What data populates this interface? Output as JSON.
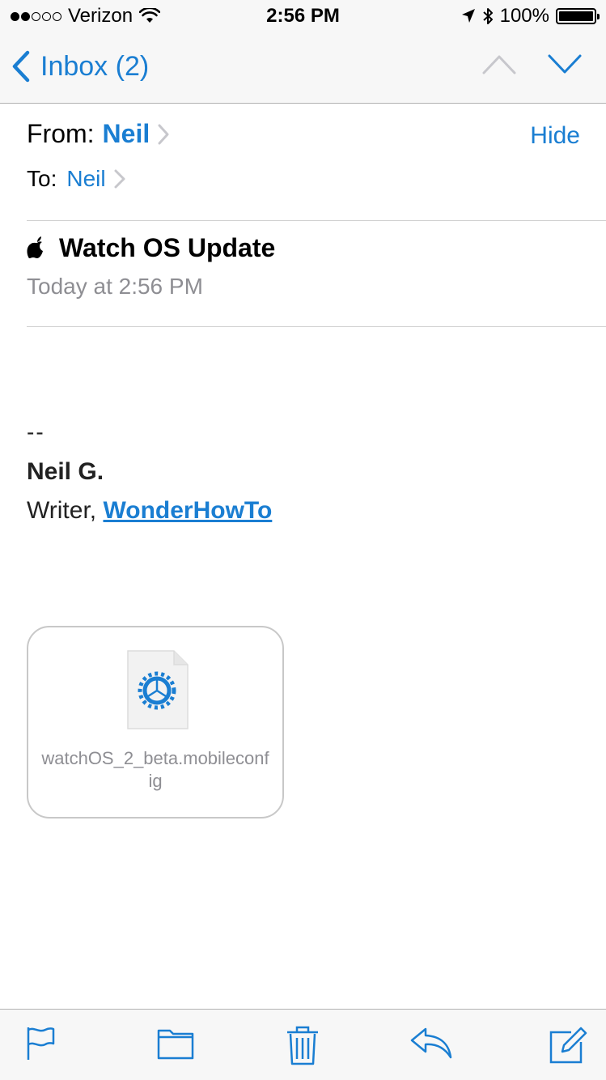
{
  "status_bar": {
    "carrier": "Verizon",
    "time": "2:56 PM",
    "battery": "100%",
    "signal_strength": 2
  },
  "nav": {
    "back_label": "Inbox (2)",
    "up_icon": "chevron-up-icon",
    "down_icon": "chevron-down-icon"
  },
  "header": {
    "from_label": "From:",
    "from_name": "Neil",
    "hide_label": "Hide",
    "to_label": "To:",
    "to_name": "Neil"
  },
  "message": {
    "subject": "Watch OS Update",
    "date": "Today at 2:56 PM"
  },
  "signature": {
    "dash": "--",
    "name": "Neil G.",
    "role": "Writer,",
    "link": "WonderHowTo"
  },
  "attachment": {
    "filename": "watchOS_2_beta.mobileconfig",
    "icon": "settings-gear-icon"
  },
  "toolbar": {
    "icons": [
      "flag-icon",
      "folder-icon",
      "trash-icon",
      "reply-icon",
      "compose-icon"
    ]
  },
  "colors": {
    "accent": "#1a7ed2",
    "secondary_text": "#8e8e93",
    "bar_background": "#f7f7f7"
  }
}
